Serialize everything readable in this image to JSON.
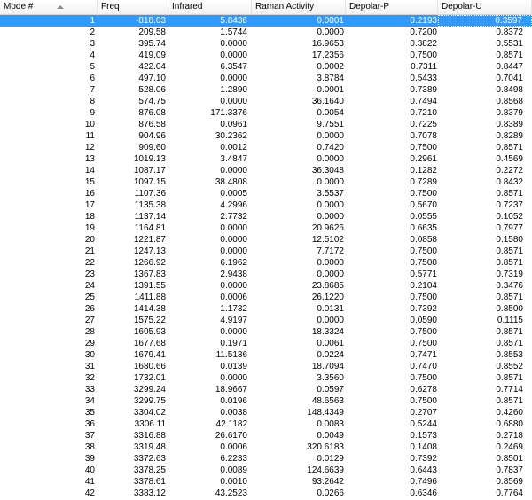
{
  "columns": [
    "Mode #",
    "Freq",
    "Infrared",
    "Raman Activity",
    "Depolar-P",
    "Depolar-U"
  ],
  "selected_row": 0,
  "rows": [
    [
      "1",
      "-818.03",
      "5.8436",
      "0.0001",
      "0.2193",
      "0.3597"
    ],
    [
      "2",
      "209.58",
      "1.5744",
      "0.0000",
      "0.7200",
      "0.8372"
    ],
    [
      "3",
      "395.74",
      "0.0000",
      "16.9653",
      "0.3822",
      "0.5531"
    ],
    [
      "4",
      "419.09",
      "0.0000",
      "17.2356",
      "0.7500",
      "0.8571"
    ],
    [
      "5",
      "422.04",
      "6.3547",
      "0.0002",
      "0.7311",
      "0.8447"
    ],
    [
      "6",
      "497.10",
      "0.0000",
      "3.8784",
      "0.5433",
      "0.7041"
    ],
    [
      "7",
      "528.06",
      "1.2890",
      "0.0001",
      "0.7389",
      "0.8498"
    ],
    [
      "8",
      "574.75",
      "0.0000",
      "36.1640",
      "0.7494",
      "0.8568"
    ],
    [
      "9",
      "876.08",
      "171.3376",
      "0.0054",
      "0.7210",
      "0.8379"
    ],
    [
      "10",
      "876.58",
      "0.0961",
      "9.7551",
      "0.7225",
      "0.8389"
    ],
    [
      "11",
      "904.96",
      "30.2362",
      "0.0000",
      "0.7078",
      "0.8289"
    ],
    [
      "12",
      "909.60",
      "0.0012",
      "0.7420",
      "0.7500",
      "0.8571"
    ],
    [
      "13",
      "1019.13",
      "3.4847",
      "0.0000",
      "0.2961",
      "0.4569"
    ],
    [
      "14",
      "1087.17",
      "0.0000",
      "36.3048",
      "0.1282",
      "0.2272"
    ],
    [
      "15",
      "1097.15",
      "38.4808",
      "0.0000",
      "0.7289",
      "0.8432"
    ],
    [
      "16",
      "1107.36",
      "0.0005",
      "3.5537",
      "0.7500",
      "0.8571"
    ],
    [
      "17",
      "1135.38",
      "4.2996",
      "0.0000",
      "0.5670",
      "0.7237"
    ],
    [
      "18",
      "1137.14",
      "2.7732",
      "0.0000",
      "0.0555",
      "0.1052"
    ],
    [
      "19",
      "1164.81",
      "0.0000",
      "20.9626",
      "0.6635",
      "0.7977"
    ],
    [
      "20",
      "1221.87",
      "0.0000",
      "12.5102",
      "0.0858",
      "0.1580"
    ],
    [
      "21",
      "1247.13",
      "0.0000",
      "7.7172",
      "0.7500",
      "0.8571"
    ],
    [
      "22",
      "1266.92",
      "6.1962",
      "0.0000",
      "0.7500",
      "0.8571"
    ],
    [
      "23",
      "1367.83",
      "2.9438",
      "0.0000",
      "0.5771",
      "0.7319"
    ],
    [
      "24",
      "1391.55",
      "0.0000",
      "23.8685",
      "0.2104",
      "0.3476"
    ],
    [
      "25",
      "1411.88",
      "0.0006",
      "26.1220",
      "0.7500",
      "0.8571"
    ],
    [
      "26",
      "1414.38",
      "1.1732",
      "0.0131",
      "0.7392",
      "0.8500"
    ],
    [
      "27",
      "1575.22",
      "4.9197",
      "0.0000",
      "0.0590",
      "0.1115"
    ],
    [
      "28",
      "1605.93",
      "0.0000",
      "18.3324",
      "0.7500",
      "0.8571"
    ],
    [
      "29",
      "1677.68",
      "0.1971",
      "0.0061",
      "0.7500",
      "0.8571"
    ],
    [
      "30",
      "1679.41",
      "11.5136",
      "0.0224",
      "0.7471",
      "0.8553"
    ],
    [
      "31",
      "1680.66",
      "0.0139",
      "18.7094",
      "0.7470",
      "0.8552"
    ],
    [
      "32",
      "1732.01",
      "0.0000",
      "3.3560",
      "0.7500",
      "0.8571"
    ],
    [
      "33",
      "3299.24",
      "18.9667",
      "0.0597",
      "0.6278",
      "0.7714"
    ],
    [
      "34",
      "3299.75",
      "0.0196",
      "48.6563",
      "0.7500",
      "0.8571"
    ],
    [
      "35",
      "3304.02",
      "0.0038",
      "148.4349",
      "0.2707",
      "0.4260"
    ],
    [
      "36",
      "3306.11",
      "42.1182",
      "0.0083",
      "0.5244",
      "0.6880"
    ],
    [
      "37",
      "3316.88",
      "26.6170",
      "0.0049",
      "0.1573",
      "0.2718"
    ],
    [
      "38",
      "3319.48",
      "0.0006",
      "320.6183",
      "0.1408",
      "0.2469"
    ],
    [
      "39",
      "3372.63",
      "6.2233",
      "0.0129",
      "0.7392",
      "0.8501"
    ],
    [
      "40",
      "3378.25",
      "0.0089",
      "124.6639",
      "0.6443",
      "0.7837"
    ],
    [
      "41",
      "3378.61",
      "0.0010",
      "93.2642",
      "0.7496",
      "0.8569"
    ],
    [
      "42",
      "3383.12",
      "43.2523",
      "0.0266",
      "0.6346",
      "0.7764"
    ]
  ]
}
